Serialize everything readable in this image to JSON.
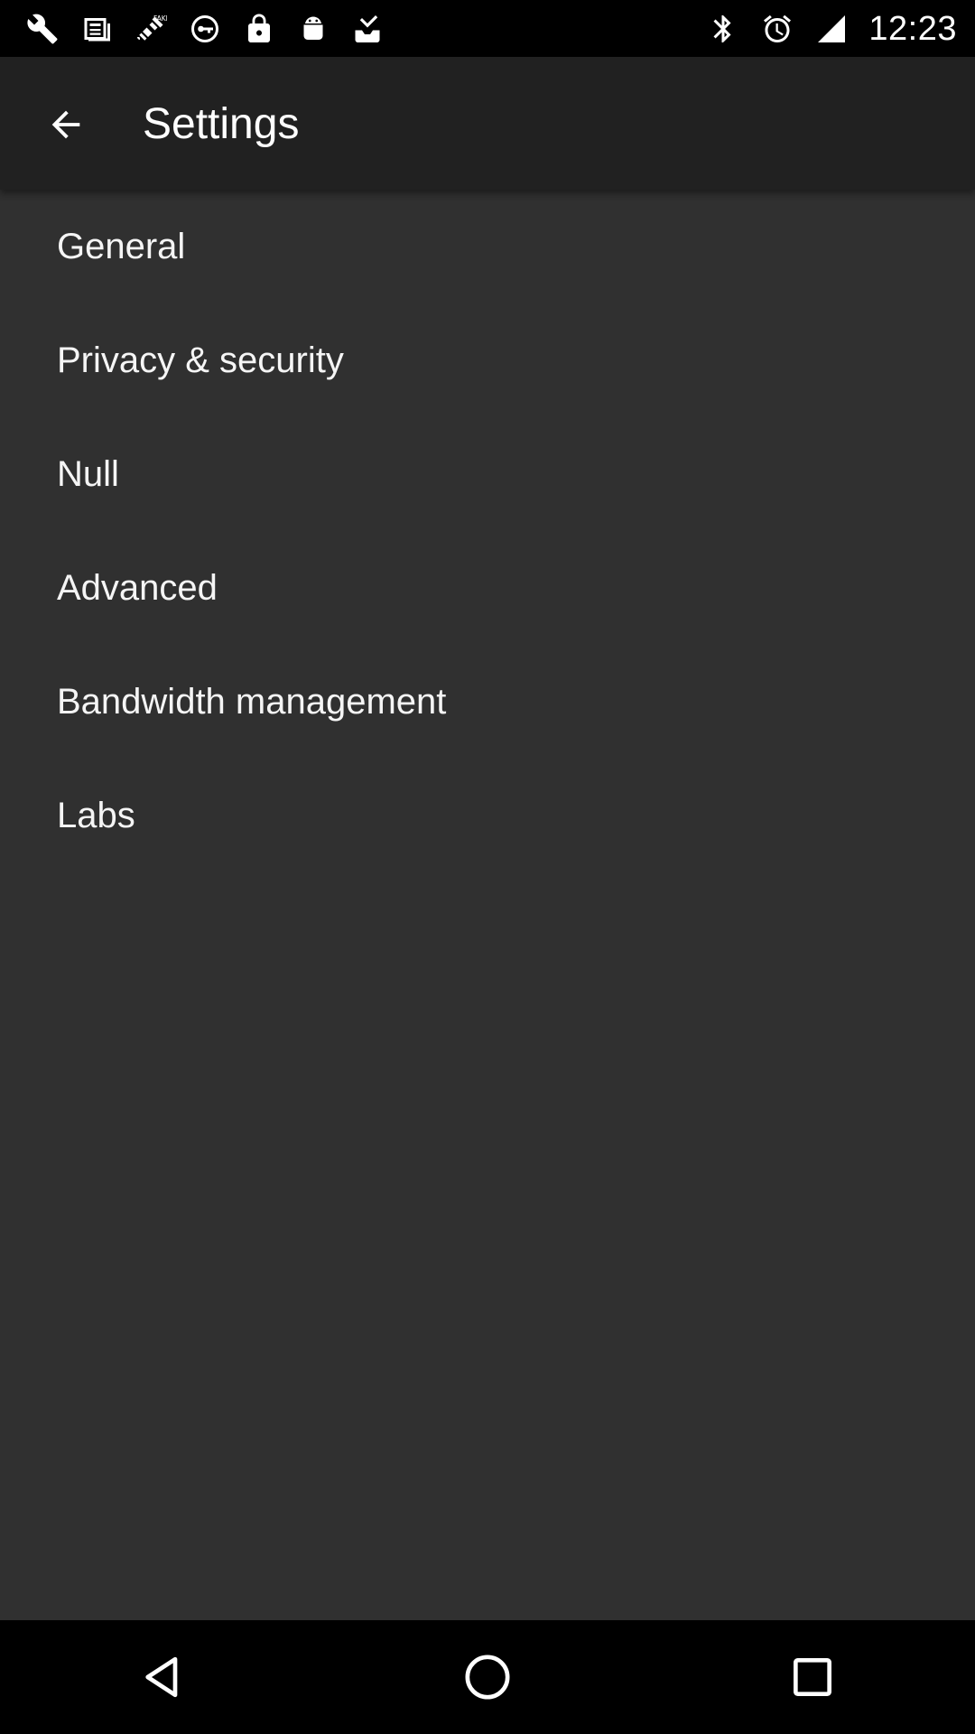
{
  "status_bar": {
    "time": "12:23",
    "left_icons": [
      "wrench-icon",
      "news-icon",
      "satellite-fake-gps-icon",
      "vpn-key-icon",
      "lock-icon",
      "android-icon",
      "inbox-download-icon"
    ],
    "right_icons": [
      "bluetooth-icon",
      "alarm-icon",
      "signal-icon"
    ]
  },
  "app_bar": {
    "title": "Settings"
  },
  "settings": {
    "items": [
      {
        "label": "General"
      },
      {
        "label": "Privacy & security"
      },
      {
        "label": "Null"
      },
      {
        "label": "Advanced"
      },
      {
        "label": "Bandwidth management"
      },
      {
        "label": "Labs"
      }
    ]
  },
  "nav_bar": {
    "buttons": [
      "back",
      "home",
      "recents"
    ]
  },
  "colors": {
    "background": "#303030",
    "app_bar": "#212121",
    "status_bar": "#000000",
    "text": "#ffffff"
  }
}
